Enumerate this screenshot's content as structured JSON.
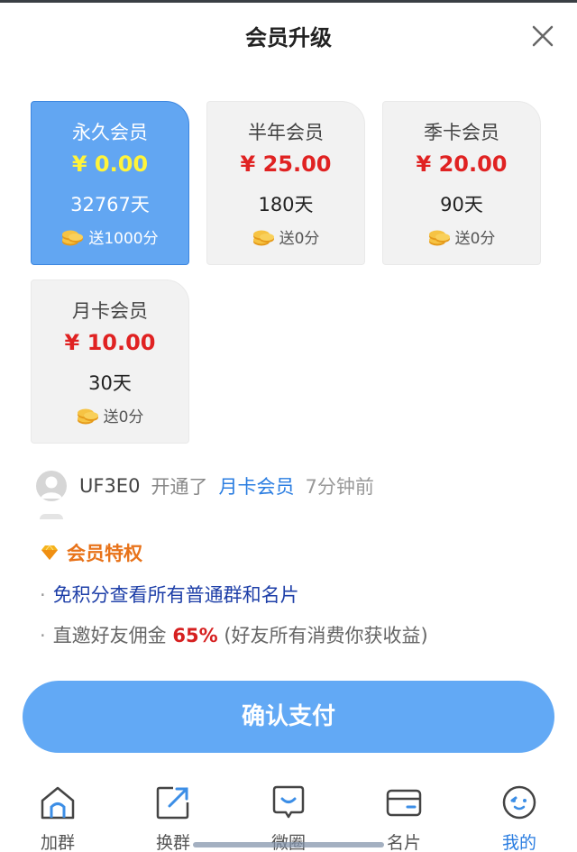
{
  "header": {
    "title": "会员升级"
  },
  "plans": [
    {
      "name": "永久会员",
      "price": "¥ 0.00",
      "days": "32767天",
      "gift": "送1000分",
      "selected": true
    },
    {
      "name": "半年会员",
      "price": "¥ 25.00",
      "days": "180天",
      "gift": "送0分",
      "selected": false
    },
    {
      "name": "季卡会员",
      "price": "¥ 20.00",
      "days": "90天",
      "gift": "送0分",
      "selected": false
    },
    {
      "name": "月卡会员",
      "price": "¥ 10.00",
      "days": "30天",
      "gift": "送0分",
      "selected": false
    }
  ],
  "notice": {
    "user": "UF3E0",
    "action": "开通了",
    "plan": "月卡会员",
    "time": "7分钟前"
  },
  "privileges": {
    "title": "会员特权",
    "items": [
      {
        "bullet": "·",
        "text": "免积分查看所有普通群和名片"
      },
      {
        "bullet": "·",
        "text_before": "直邀好友佣金",
        "highlight": "65%",
        "text_after": "(好友所有消费你获收益)"
      }
    ]
  },
  "pay_button": {
    "label": "确认支付"
  },
  "tabs": [
    {
      "label": "加群",
      "icon": "home-icon",
      "active": false
    },
    {
      "label": "换群",
      "icon": "share-arrow-icon",
      "active": false
    },
    {
      "label": "微圈",
      "icon": "chat-bubble-icon",
      "active": false
    },
    {
      "label": "名片",
      "icon": "card-icon",
      "active": false
    },
    {
      "label": "我的",
      "icon": "smiley-face-icon",
      "active": true
    }
  ],
  "colors": {
    "accent": "#62a6f2",
    "price_red": "#e02222",
    "active_price": "#fff43a",
    "link_blue": "#2a7de1",
    "privilege_orange": "#e8731a"
  }
}
